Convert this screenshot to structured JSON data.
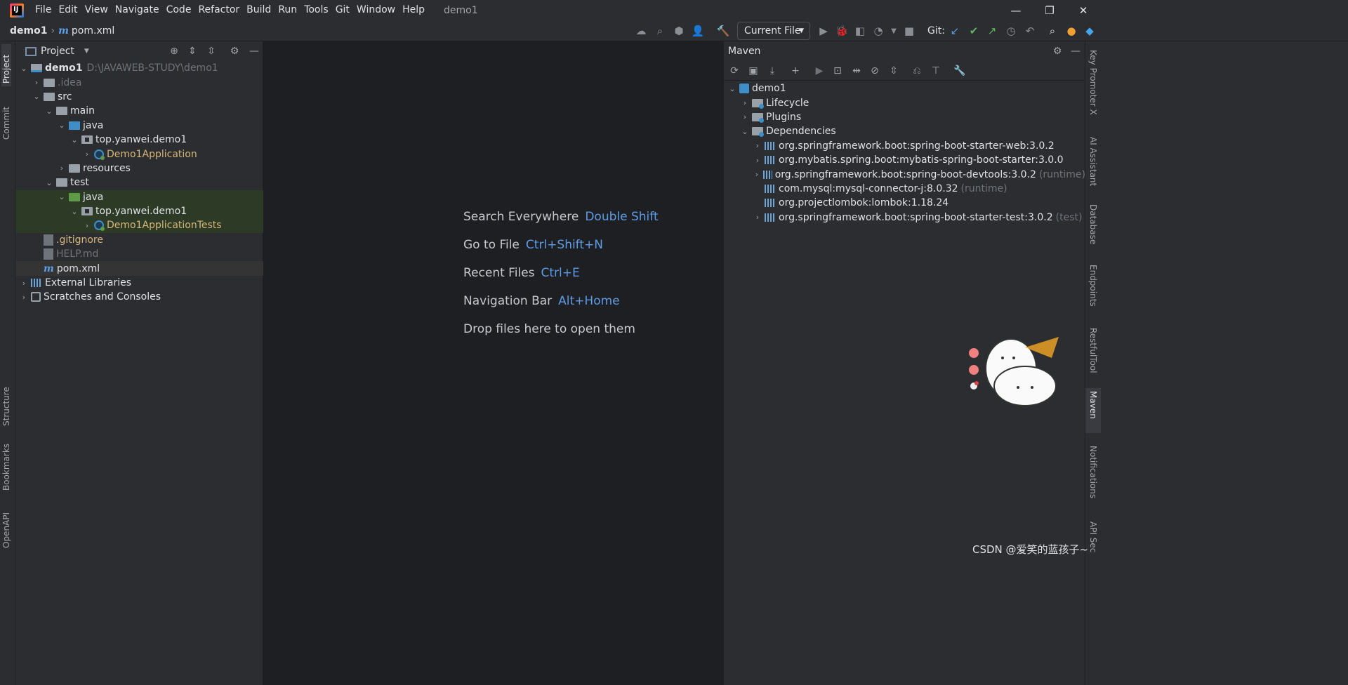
{
  "menu": {
    "items": [
      "File",
      "Edit",
      "View",
      "Navigate",
      "Code",
      "Refactor",
      "Build",
      "Run",
      "Tools",
      "Git",
      "Window",
      "Help"
    ],
    "window_title": "demo1"
  },
  "navbar": {
    "project": "demo1",
    "file": "pom.xml",
    "run_config": "Current File",
    "git_label": "Git:"
  },
  "left_tabs": [
    "Project",
    "Commit",
    "Structure",
    "Bookmarks",
    "OpenAPI"
  ],
  "right_tabs": [
    "Key Promoter X",
    "AI Assistant",
    "Database",
    "Endpoints",
    "RestfulTool",
    "Maven",
    "Notifications",
    "API Sec"
  ],
  "project_panel": {
    "title": "Project",
    "tree": [
      {
        "label": "demo1",
        "path": "D:\\JAVAWEB-STUDY\\demo1",
        "depth": 0,
        "chevron": "down",
        "icon": "module"
      },
      {
        "label": ".idea",
        "depth": 1,
        "chevron": "right",
        "icon": "folder-gray",
        "style": "gray"
      },
      {
        "label": "src",
        "depth": 1,
        "chevron": "down",
        "icon": "folder-gray"
      },
      {
        "label": "main",
        "depth": 2,
        "chevron": "down",
        "icon": "folder-gray"
      },
      {
        "label": "java",
        "depth": 3,
        "chevron": "down",
        "icon": "folder-blue"
      },
      {
        "label": "top.yanwei.demo1",
        "depth": 4,
        "chevron": "down",
        "icon": "package"
      },
      {
        "label": "Demo1Application",
        "depth": 5,
        "chevron": "right",
        "icon": "class",
        "style": "yellow"
      },
      {
        "label": "resources",
        "depth": 3,
        "chevron": "right",
        "icon": "folder-gray"
      },
      {
        "label": "test",
        "depth": 2,
        "chevron": "down",
        "icon": "folder-gray"
      },
      {
        "label": "java",
        "depth": 3,
        "chevron": "down",
        "icon": "folder-green",
        "highlight": true
      },
      {
        "label": "top.yanwei.demo1",
        "depth": 4,
        "chevron": "down",
        "icon": "package",
        "highlight": true
      },
      {
        "label": "Demo1ApplicationTests",
        "depth": 5,
        "chevron": "right",
        "icon": "class",
        "style": "yellow",
        "highlight": true
      },
      {
        "label": ".gitignore",
        "depth": 1,
        "chevron": "",
        "icon": "file",
        "style": "yellow"
      },
      {
        "label": "HELP.md",
        "depth": 1,
        "chevron": "",
        "icon": "file",
        "style": "gray"
      },
      {
        "label": "pom.xml",
        "depth": 1,
        "chevron": "",
        "icon": "maven",
        "selected": true
      },
      {
        "label": "External Libraries",
        "depth": 0,
        "chevron": "right",
        "icon": "library"
      },
      {
        "label": "Scratches and Consoles",
        "depth": 0,
        "chevron": "right",
        "icon": "scratch"
      }
    ]
  },
  "editor": {
    "hints": [
      {
        "label": "Search Everywhere",
        "key": "Double Shift"
      },
      {
        "label": "Go to File",
        "key": "Ctrl+Shift+N"
      },
      {
        "label": "Recent Files",
        "key": "Ctrl+E"
      },
      {
        "label": "Navigation Bar",
        "key": "Alt+Home"
      },
      {
        "label": "Drop files here to open them",
        "key": ""
      }
    ]
  },
  "maven_panel": {
    "title": "Maven",
    "tree": [
      {
        "label": "demo1",
        "depth": 0,
        "chevron": "down",
        "icon": "module"
      },
      {
        "label": "Lifecycle",
        "depth": 1,
        "chevron": "right",
        "icon": "gfolder"
      },
      {
        "label": "Plugins",
        "depth": 1,
        "chevron": "right",
        "icon": "gfolder"
      },
      {
        "label": "Dependencies",
        "depth": 1,
        "chevron": "down",
        "icon": "gfolder"
      },
      {
        "label": "org.springframework.boot:spring-boot-starter-web:3.0.2",
        "depth": 2,
        "chevron": "right",
        "icon": "bars",
        "scope": ""
      },
      {
        "label": "org.mybatis.spring.boot:mybatis-spring-boot-starter:3.0.0",
        "depth": 2,
        "chevron": "right",
        "icon": "bars",
        "scope": ""
      },
      {
        "label": "org.springframework.boot:spring-boot-devtools:3.0.2",
        "depth": 2,
        "chevron": "right",
        "icon": "bars",
        "scope": "(runtime)"
      },
      {
        "label": "com.mysql:mysql-connector-j:8.0.32",
        "depth": 2,
        "chevron": "",
        "icon": "bars",
        "scope": "(runtime)"
      },
      {
        "label": "org.projectlombok:lombok:1.18.24",
        "depth": 2,
        "chevron": "",
        "icon": "bars",
        "scope": ""
      },
      {
        "label": "org.springframework.boot:spring-boot-starter-test:3.0.2",
        "depth": 2,
        "chevron": "right",
        "icon": "bars",
        "scope": "(test)"
      }
    ]
  },
  "watermark": "CSDN @爱笑的蓝孩子~",
  "colors": {
    "accent": "#5c9ce6",
    "background": "#2b2d30",
    "editor": "#1e1f22",
    "highlight": "#2c3a26"
  }
}
